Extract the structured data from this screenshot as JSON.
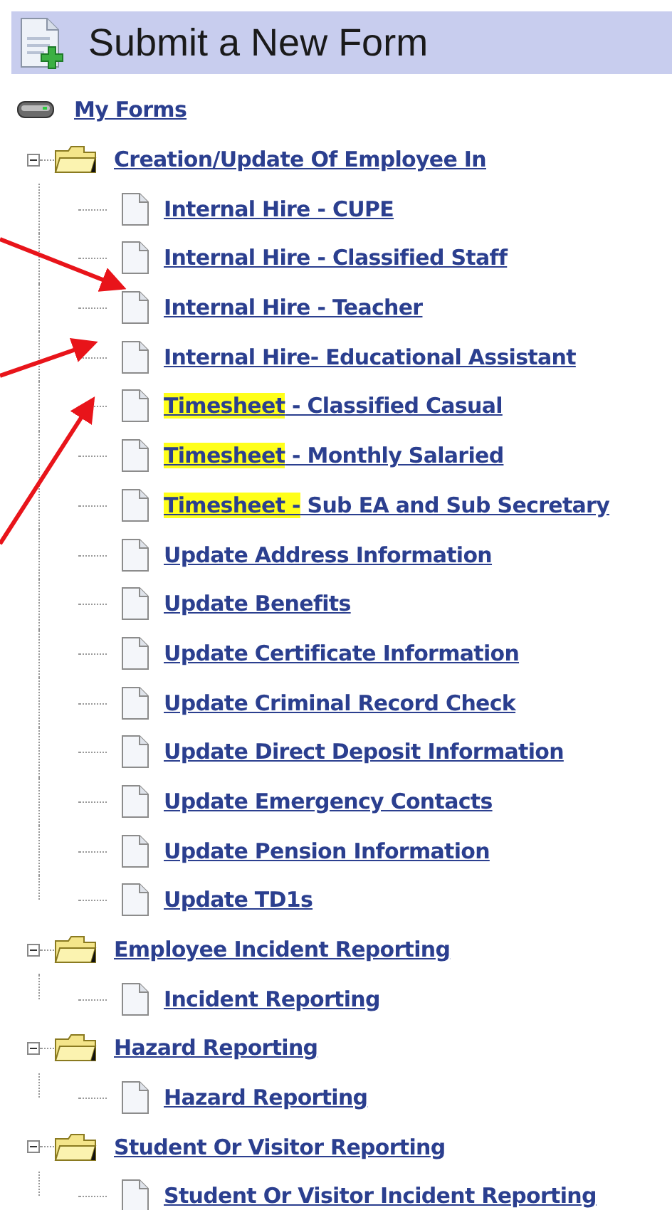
{
  "header": {
    "title": "Submit a New Form"
  },
  "root": {
    "label": "My Forms"
  },
  "groups": [
    {
      "label": "Creation/Update Of Employee In",
      "expanded": true,
      "children": [
        {
          "label": "Internal Hire - CUPE"
        },
        {
          "label": "Internal Hire - Classified Staff"
        },
        {
          "label": "Internal Hire - Teacher"
        },
        {
          "label": "Internal Hire- Educational Assistant"
        },
        {
          "highlight": "Timesheet",
          "label": " - Classified Casual"
        },
        {
          "highlight": "Timesheet",
          "label": " - Monthly Salaried"
        },
        {
          "highlight": "Timesheet -",
          "label": " Sub EA and Sub Secretary"
        },
        {
          "label": "Update Address Information"
        },
        {
          "label": "Update Benefits"
        },
        {
          "label": "Update Certificate Information"
        },
        {
          "label": "Update Criminal Record Check"
        },
        {
          "label": "Update Direct Deposit Information"
        },
        {
          "label": "Update Emergency Contacts"
        },
        {
          "label": "Update Pension Information"
        },
        {
          "label": "Update TD1s"
        }
      ]
    },
    {
      "label": "Employee Incident Reporting",
      "expanded": true,
      "children": [
        {
          "label": "Incident Reporting"
        }
      ]
    },
    {
      "label": "Hazard Reporting",
      "expanded": true,
      "children": [
        {
          "label": "Hazard Reporting"
        }
      ]
    },
    {
      "label": "Student Or Visitor Reporting",
      "expanded": true,
      "children": [
        {
          "label": "Student Or Visitor Incident Reporting"
        }
      ]
    }
  ]
}
